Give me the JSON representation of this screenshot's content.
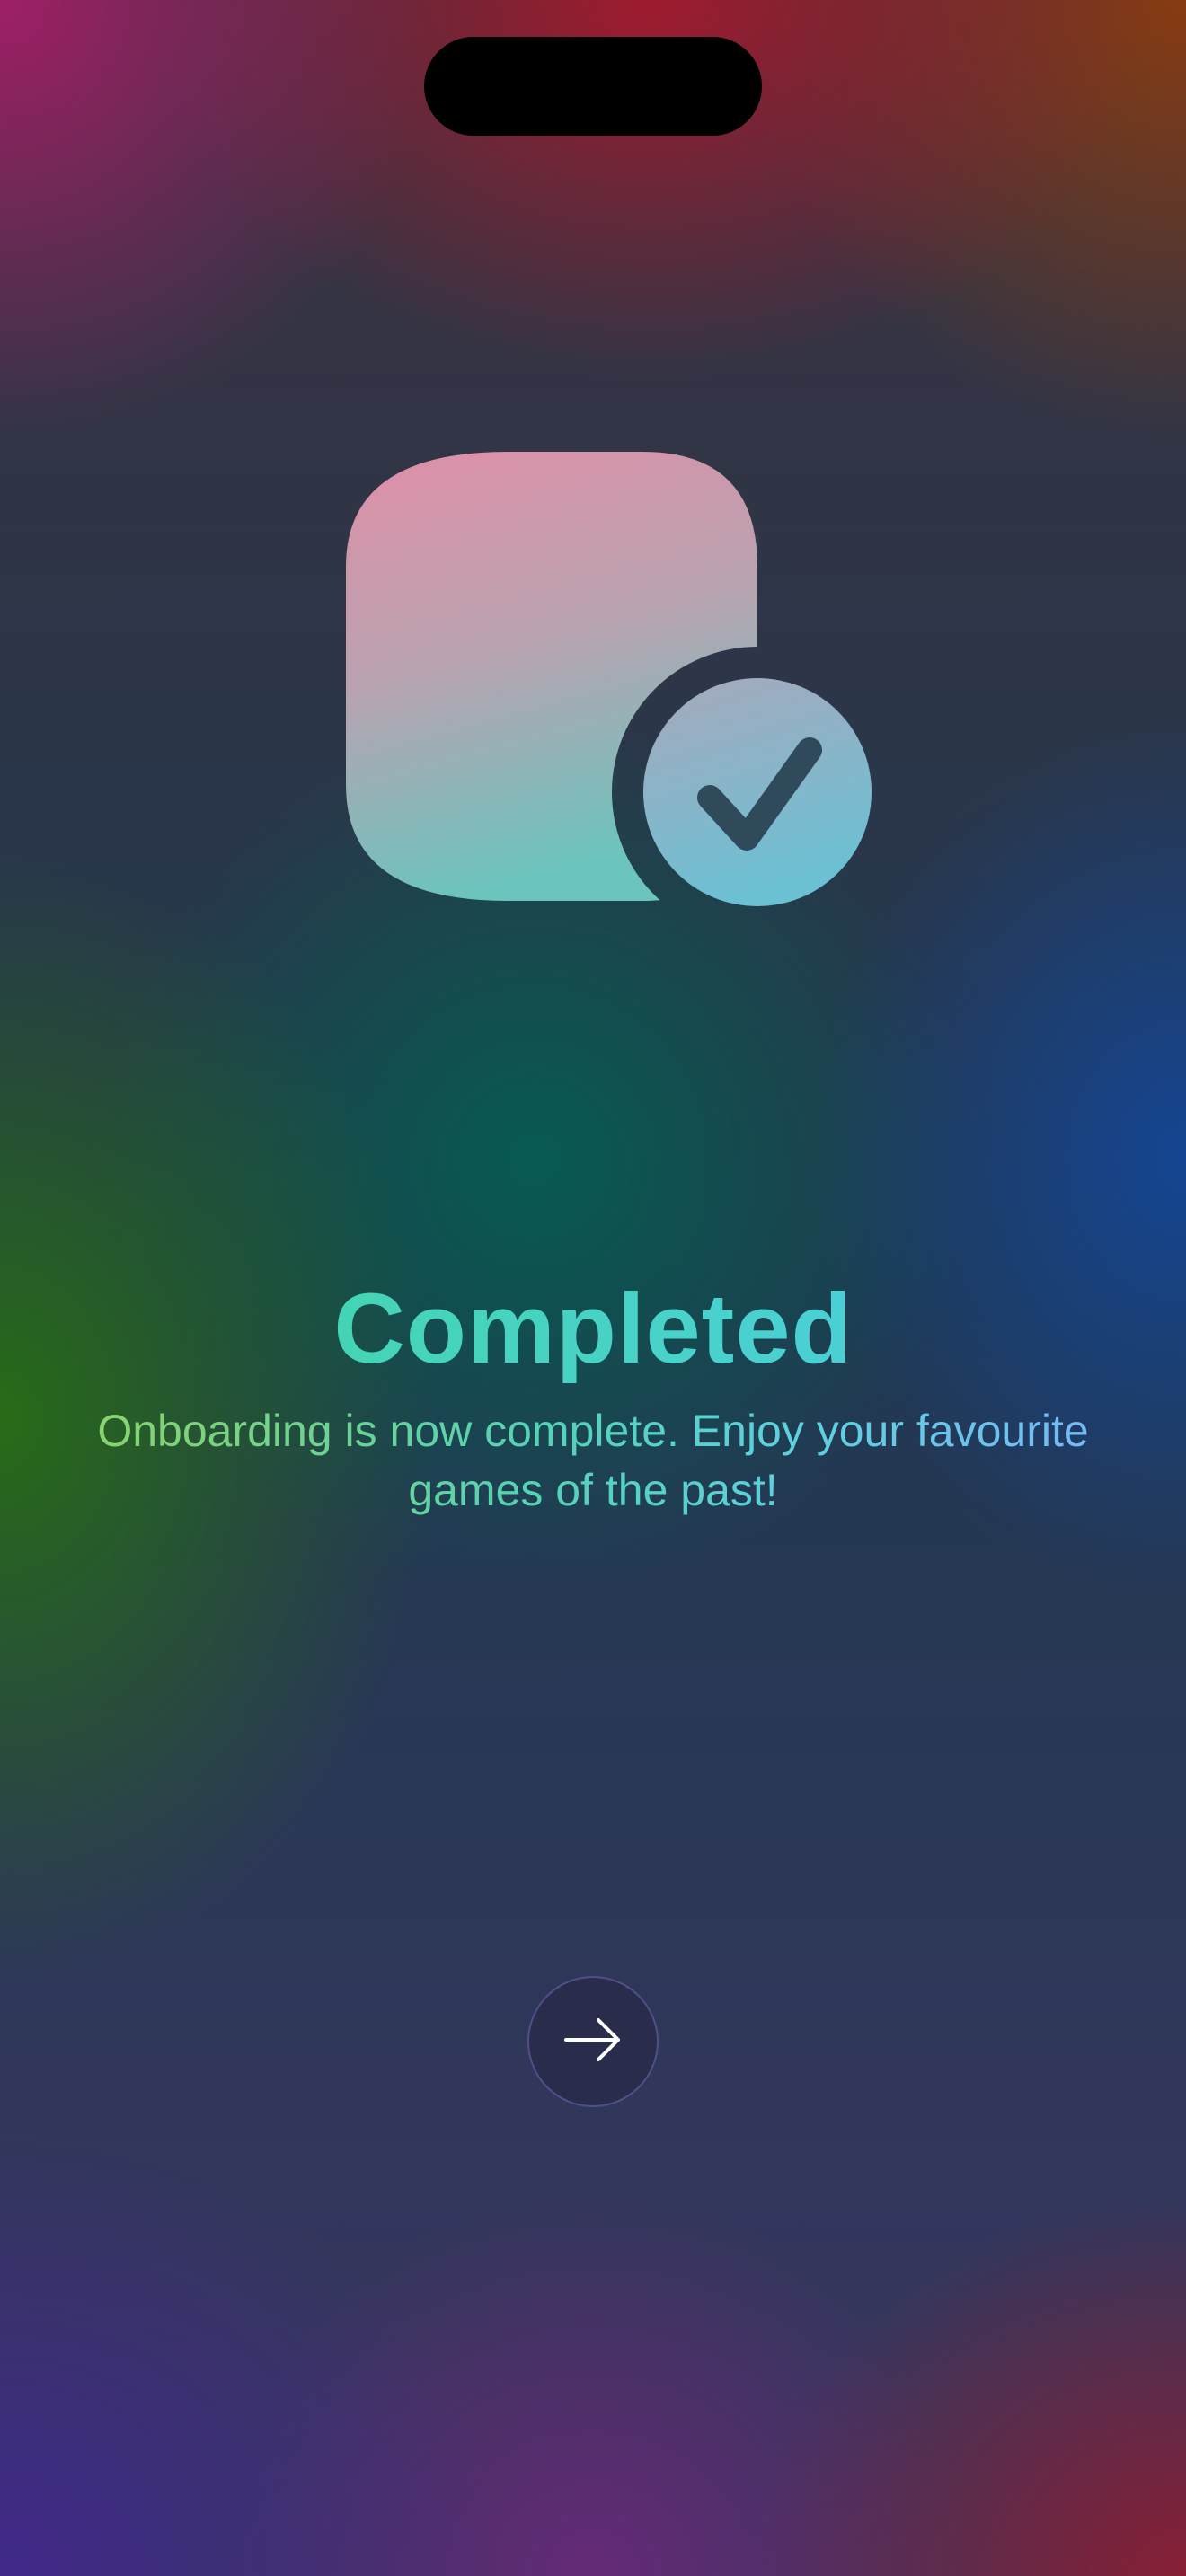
{
  "onboarding": {
    "title": "Completed",
    "subtitle": "Onboarding is now complete. Enjoy your favourite games of the past!",
    "hero_icon": "app-checkmark-icon",
    "next_button_icon": "arrow-right-icon"
  },
  "colors": {
    "title_gradient_start": "#3fd6a0",
    "title_gradient_end": "#4ec8ea",
    "button_background": "#2a2c4c",
    "icon_tile_top": "#e08fa8",
    "icon_tile_bottom": "#6cc4be",
    "badge_bottom": "#6cc0d4"
  }
}
